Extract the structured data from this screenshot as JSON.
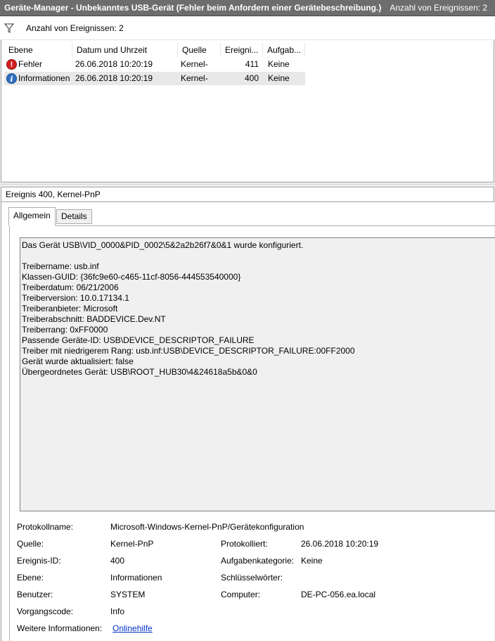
{
  "window": {
    "title": "Geräte-Manager - Unbekanntes USB-Gerät (Fehler beim Anfordern einer Gerätebeschreibung.)",
    "event_count": "Anzahl von Ereignissen: 2"
  },
  "filter": {
    "label": "Anzahl von Ereignissen: 2"
  },
  "table": {
    "columns": [
      "Ebene",
      "Datum und Uhrzeit",
      "Quelle",
      "Ereigni...",
      "Aufgab..."
    ],
    "rows": [
      {
        "level": "Fehler",
        "icon": "error-icon",
        "datetime": "26.06.2018 10:20:19",
        "source": "Kernel-",
        "event_id": "411",
        "task": "Keine"
      },
      {
        "level": "Informationen",
        "icon": "info-icon",
        "datetime": "26.06.2018 10:20:19",
        "source": "Kernel-",
        "event_id": "400",
        "task": "Keine"
      }
    ]
  },
  "detail": {
    "header": "Ereignis 400, Kernel-PnP",
    "tabs": [
      "Allgemein",
      "Details"
    ],
    "description": [
      "Das Gerät USB\\VID_0000&PID_0002\\5&2a2b26f7&0&1 wurde konfiguriert.",
      "",
      "Treibername: usb.inf",
      "Klassen-GUID: {36fc9e60-c465-11cf-8056-444553540000}",
      "Treiberdatum: 06/21/2006",
      "Treiberversion: 10.0.17134.1",
      "Treiberanbieter: Microsoft",
      "Treiberabschnitt: BADDEVICE.Dev.NT",
      "Treiberrang: 0xFF0000",
      "Passende Geräte-ID: USB\\DEVICE_DESCRIPTOR_FAILURE",
      "Treiber mit niedrigerem Rang: usb.inf:USB\\DEVICE_DESCRIPTOR_FAILURE:00FF2000",
      "Gerät wurde aktualisiert: false",
      "Übergeordnetes Gerät: USB\\ROOT_HUB30\\4&24618a5b&0&0"
    ],
    "props": {
      "logname_label": "Protokollname:",
      "logname": "Microsoft-Windows-Kernel-PnP/Gerätekonfiguration",
      "source_label": "Quelle:",
      "source": "Kernel-PnP",
      "logged_label": "Protokolliert:",
      "logged": "26.06.2018 10:20:19",
      "eventid_label": "Ereignis-ID:",
      "eventid": "400",
      "task_label": "Aufgabenkategorie:",
      "task": "Keine",
      "level_label": "Ebene:",
      "level": "Informationen",
      "keywords_label": "Schlüsselwörter:",
      "keywords": "",
      "user_label": "Benutzer:",
      "user": "SYSTEM",
      "computer_label": "Computer:",
      "computer": "DE-PC-056.ea.local",
      "opcode_label": "Vorgangscode:",
      "opcode": "Info",
      "moreinfo_label": "Weitere Informationen:",
      "moreinfo_link": "Onlinehilfe"
    }
  }
}
